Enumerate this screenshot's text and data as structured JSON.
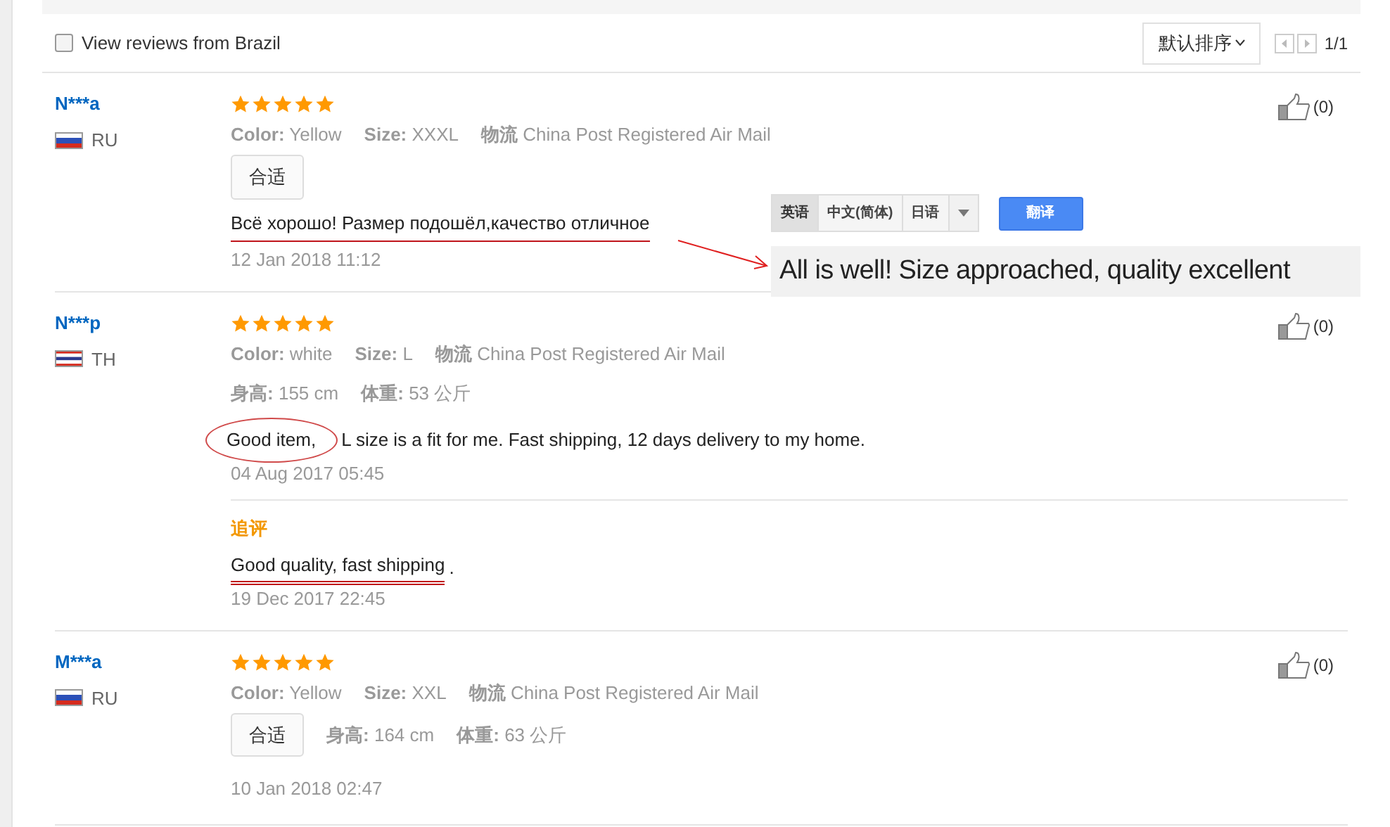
{
  "filter": {
    "label": "View reviews from Brazil",
    "checked": false
  },
  "sort": {
    "label": "默认排序"
  },
  "pager": {
    "text": "1/1"
  },
  "reviews": [
    {
      "name": "N***a",
      "country": "RU",
      "flag": {
        "kind": "tricolor"
      },
      "stars": 5,
      "details": [
        {
          "label": "Color:",
          "value": "Yellow"
        },
        {
          "label": "Size:",
          "value": "XXXL"
        },
        {
          "label": "物流",
          "value": "China Post Registered Air Mail"
        }
      ],
      "tag": "合适",
      "text": [
        {
          "t": "Всё хорошо! Размер подошёл,качество отличное",
          "kind": "underline"
        }
      ],
      "date": "12 Jan 2018 11:12",
      "likes": "(0)",
      "translation": {
        "languages": [
          {
            "label": "英语",
            "selected": true
          },
          {
            "label": "中文(简体)",
            "selected": false
          },
          {
            "label": "日语",
            "selected": false
          }
        ],
        "button": "翻译",
        "result": "All is well! Size approached, quality excellent"
      }
    },
    {
      "name": "N***p",
      "country": "TH",
      "flag": {
        "kind": "striped"
      },
      "stars": 5,
      "details": [
        {
          "label": "Color:",
          "value": "white"
        },
        {
          "label": "Size:",
          "value": "L"
        },
        {
          "label": "物流",
          "value": "China Post Registered Air Mail"
        }
      ],
      "extra": [
        {
          "label": "身高:",
          "value": "155 cm"
        },
        {
          "label": "体重:",
          "value": "53 公斤"
        }
      ],
      "text": [
        {
          "t": "Good item,",
          "kind": "circle"
        },
        {
          "t": "L size is a fit for me. Fast shipping, 12 days delivery to my home.",
          "kind": "plain"
        }
      ],
      "date": "04 Aug 2017 05:45",
      "likes": "(0)",
      "followup": {
        "label": "追评",
        "text": [
          {
            "t": "Good quality, fast shipping",
            "kind": "double_underline"
          },
          {
            "t": ".",
            "kind": "plain"
          }
        ],
        "date": "19 Dec 2017 22:45"
      }
    },
    {
      "name": "M***a",
      "country": "RU",
      "flag": {
        "kind": "tricolor"
      },
      "stars": 5,
      "details": [
        {
          "label": "Color:",
          "value": "Yellow"
        },
        {
          "label": "Size:",
          "value": "XXL"
        },
        {
          "label": "物流",
          "value": "China Post Registered Air Mail"
        }
      ],
      "tag": "合适",
      "extra": [
        {
          "label": "身高:",
          "value": "164 cm"
        },
        {
          "label": "体重:",
          "value": "63 公斤"
        }
      ],
      "date": "10 Jan 2018 02:47",
      "likes": "(0)"
    }
  ]
}
